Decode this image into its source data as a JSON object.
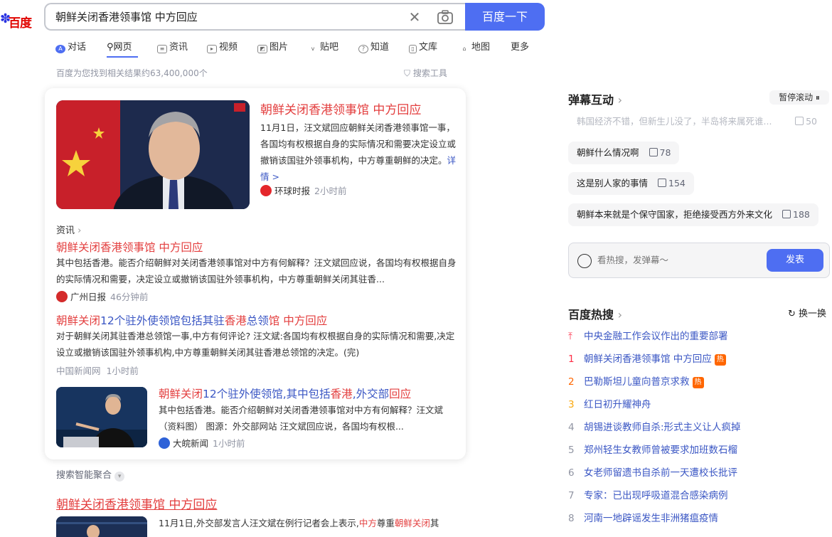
{
  "logo": {
    "text": "百度"
  },
  "search": {
    "query": "朝鲜关闭香港领事馆 中方回应",
    "button": "百度一下"
  },
  "tabs": [
    {
      "label": "对话"
    },
    {
      "label": "网页"
    },
    {
      "label": "资讯"
    },
    {
      "label": "视频"
    },
    {
      "label": "图片"
    },
    {
      "label": "贴吧"
    },
    {
      "label": "知道"
    },
    {
      "label": "文库"
    },
    {
      "label": "地图"
    },
    {
      "label": "更多"
    }
  ],
  "result_count": "百度为您找到相关结果约63,400,000个",
  "search_tools": "搜索工具",
  "card": {
    "main_title": "朝鲜关闭香港领事馆 中方回应",
    "main_desc": "11月1日，汪文斌回应朝鲜关闭香港领事馆一事，各国均有权根据自身的实际情况和需要决定设立或撤销该国驻外领事机构，中方尊重朝鲜的决定。",
    "main_more": "详情 >",
    "main_source": "环球时报",
    "main_time": "2小时前",
    "section_label": "资讯",
    "news": [
      {
        "title": "朝鲜关闭香港领事馆 中方回应",
        "desc": "其中包括香港。能否介绍朝鲜对关闭香港领事馆对中方有何解释？汪文斌回应说，各国均有权根据自身的实际情况和需要，决定设立或撤销该国驻外领事机构，中方尊重朝鲜关闭其驻香...",
        "source": "广州日报",
        "time": "46分钟前"
      },
      {
        "title_a": "朝鲜关闭",
        "title_b": "12个驻外使领馆包括其驻",
        "title_c": "香港",
        "title_d": "总领",
        "title_e": "馆 中方回应",
        "desc": "对于朝鲜关闭其驻香港总领馆一事,中方有何评论? 汪文斌:各国均有权根据自身的实际情况和需要,决定设立或撤销该国驻外领事机构,中方尊重朝鲜关闭其驻香港总领馆的决定。(完)",
        "source": "中国新闻网",
        "time": "1小时前"
      },
      {
        "title_a": "朝鲜关闭",
        "title_b": "12个驻外使领馆,其中包括",
        "title_c": "香港",
        "title_d": ",外交部",
        "title_e": "回应",
        "desc": "其中包括香港。能否介绍朝鲜对关闭香港领事馆对中方有何解释？汪文斌（资料图） 图源：外交部网站 汪文斌回应说，各国均有权根...",
        "source": "大皖新闻",
        "time": "1小时前"
      }
    ]
  },
  "smart_agg": "搜索智能聚合",
  "bottom": {
    "title": "朝鲜关闭香港领事馆 中方回应",
    "desc_a": "11月1日,外交部发言人汪文斌在例行记者会上表示,",
    "desc_b": "中方",
    "desc_c": "尊重",
    "desc_d": "朝鲜关闭",
    "desc_e": "其"
  },
  "danmu": {
    "title": "弹幕互动",
    "pause": "暂停滚动 ⏸",
    "items": [
      {
        "text": "韩国经济不错，但新生儿没了，半岛将来属死谁...",
        "likes": "50"
      },
      {
        "text": "朝鲜什么情况啊",
        "likes": "78"
      },
      {
        "text": "这是别人家的事情",
        "likes": "154"
      },
      {
        "text": "朝鲜本来就是个保守国家，拒绝接受西方外来文化",
        "likes": "188"
      }
    ],
    "placeholder": "看热搜，发弹幕～",
    "publish": "发表"
  },
  "hot": {
    "title": "百度热搜",
    "refresh": "换一换",
    "items": [
      {
        "rank": "",
        "text": "中央金融工作会议作出的重要部署",
        "badge": ""
      },
      {
        "rank": "1",
        "text": "朝鲜关闭香港领事馆 中方回应",
        "badge": "热"
      },
      {
        "rank": "2",
        "text": "巴勒斯坦儿童向普京求救",
        "badge": "热"
      },
      {
        "rank": "3",
        "text": "红日初升耀神舟",
        "badge": ""
      },
      {
        "rank": "4",
        "text": "胡锡进谈教师自杀:形式主义让人疯掉",
        "badge": ""
      },
      {
        "rank": "5",
        "text": "郑州轻生女教师曾被要求加班数石榴",
        "badge": ""
      },
      {
        "rank": "6",
        "text": "女老师留遗书自杀前一天遭校长批评",
        "badge": ""
      },
      {
        "rank": "7",
        "text": "专家：已出现呼吸道混合感染病例",
        "badge": ""
      },
      {
        "rank": "8",
        "text": "河南一地辟谣发生非洲猪瘟疫情",
        "badge": ""
      }
    ]
  },
  "colors": {
    "accent": "#4e6ef2",
    "title_red": "#e33e3e",
    "link_blue": "#3b57c4"
  }
}
